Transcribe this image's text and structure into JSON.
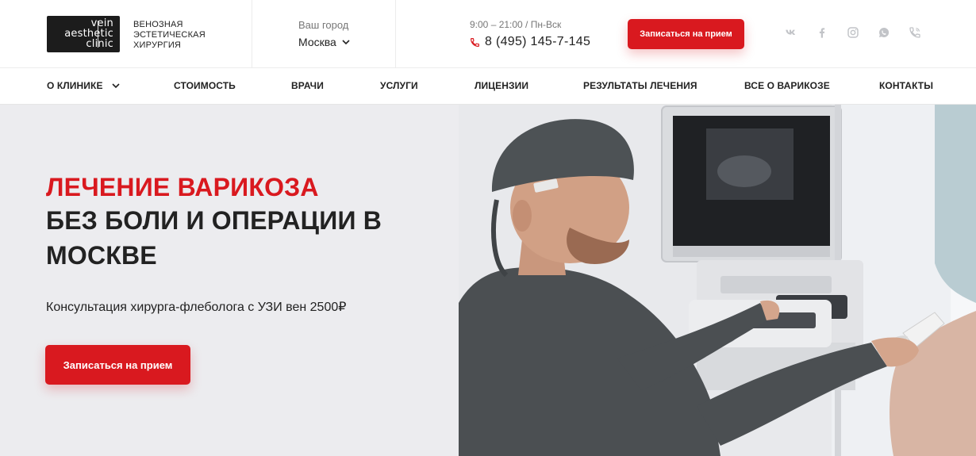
{
  "logo": {
    "line1": "vein",
    "line2": "aesthetic",
    "line3": "clinic",
    "tagline": [
      "ВЕНОЗНАЯ",
      "ЭСТЕТИЧЕСКАЯ",
      "ХИРУРГИЯ"
    ]
  },
  "city": {
    "label": "Ваш город",
    "value": "Москва",
    "icon": "chevron-down-icon"
  },
  "contact": {
    "hours": "9:00 – 21:00 / Пн-Вск",
    "phone": "8 (495) 145-7-145",
    "phone_icon": "phone-icon"
  },
  "header_button": "Записаться на прием",
  "socials": [
    "vk-icon",
    "facebook-icon",
    "instagram-icon",
    "whatsapp-icon",
    "viber-icon"
  ],
  "nav": {
    "items": [
      {
        "label": "О КЛИНИКЕ",
        "has_dropdown": true
      },
      {
        "label": "СТОИМОСТЬ"
      },
      {
        "label": "ВРАЧИ"
      },
      {
        "label": "УСЛУГИ"
      },
      {
        "label": "ЛИЦЕНЗИИ"
      },
      {
        "label": "РЕЗУЛЬТАТЫ ЛЕЧЕНИЯ"
      },
      {
        "label": "ВСЕ О ВАРИКОЗЕ"
      },
      {
        "label": "КОНТАКТЫ"
      }
    ]
  },
  "hero": {
    "title_red": "ЛЕЧЕНИЕ ВАРИКОЗА",
    "title_line2": "БЕЗ БОЛИ И ОПЕРАЦИИ В",
    "title_line3": "МОСКВЕ",
    "subtitle": "Консультация хирурга-флеболога с УЗИ вен 2500₽",
    "button": "Записаться на прием"
  },
  "colors": {
    "accent": "#d9191f",
    "text": "#222222",
    "hero_bg": "#ececef"
  }
}
